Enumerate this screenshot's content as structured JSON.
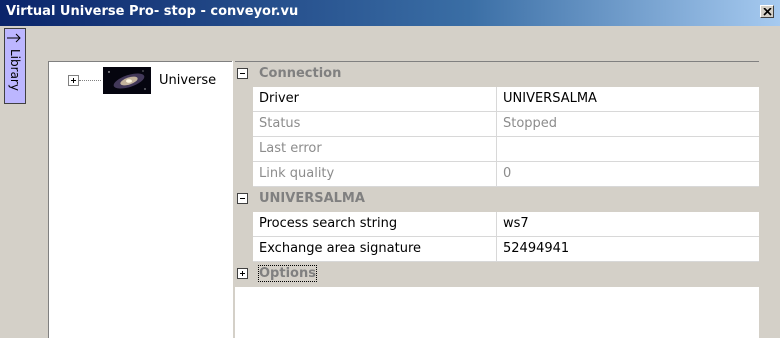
{
  "window": {
    "title": "Virtual Universe Pro- stop - conveyor.vu"
  },
  "library_tab": {
    "label": "Library"
  },
  "tree": {
    "root_label": "Universe"
  },
  "properties": {
    "categories": [
      {
        "label": "Connection",
        "expanded": true
      },
      {
        "label": "UNIVERSALMA",
        "expanded": true
      },
      {
        "label": "Options",
        "expanded": false
      }
    ],
    "rows": [
      {
        "name": "Driver",
        "value": "UNIVERSALMA"
      },
      {
        "name": "Status",
        "value": "Stopped"
      },
      {
        "name": "Last error",
        "value": ""
      },
      {
        "name": "Link quality",
        "value": "0"
      },
      {
        "name": "Process search string",
        "value": "ws7"
      },
      {
        "name": "Exchange area signature",
        "value": "52494941"
      }
    ]
  },
  "colors": {
    "title_bar": "#0a246a",
    "library_tab": "#bcb6ff",
    "readonly_text": "#8c8c8c"
  }
}
